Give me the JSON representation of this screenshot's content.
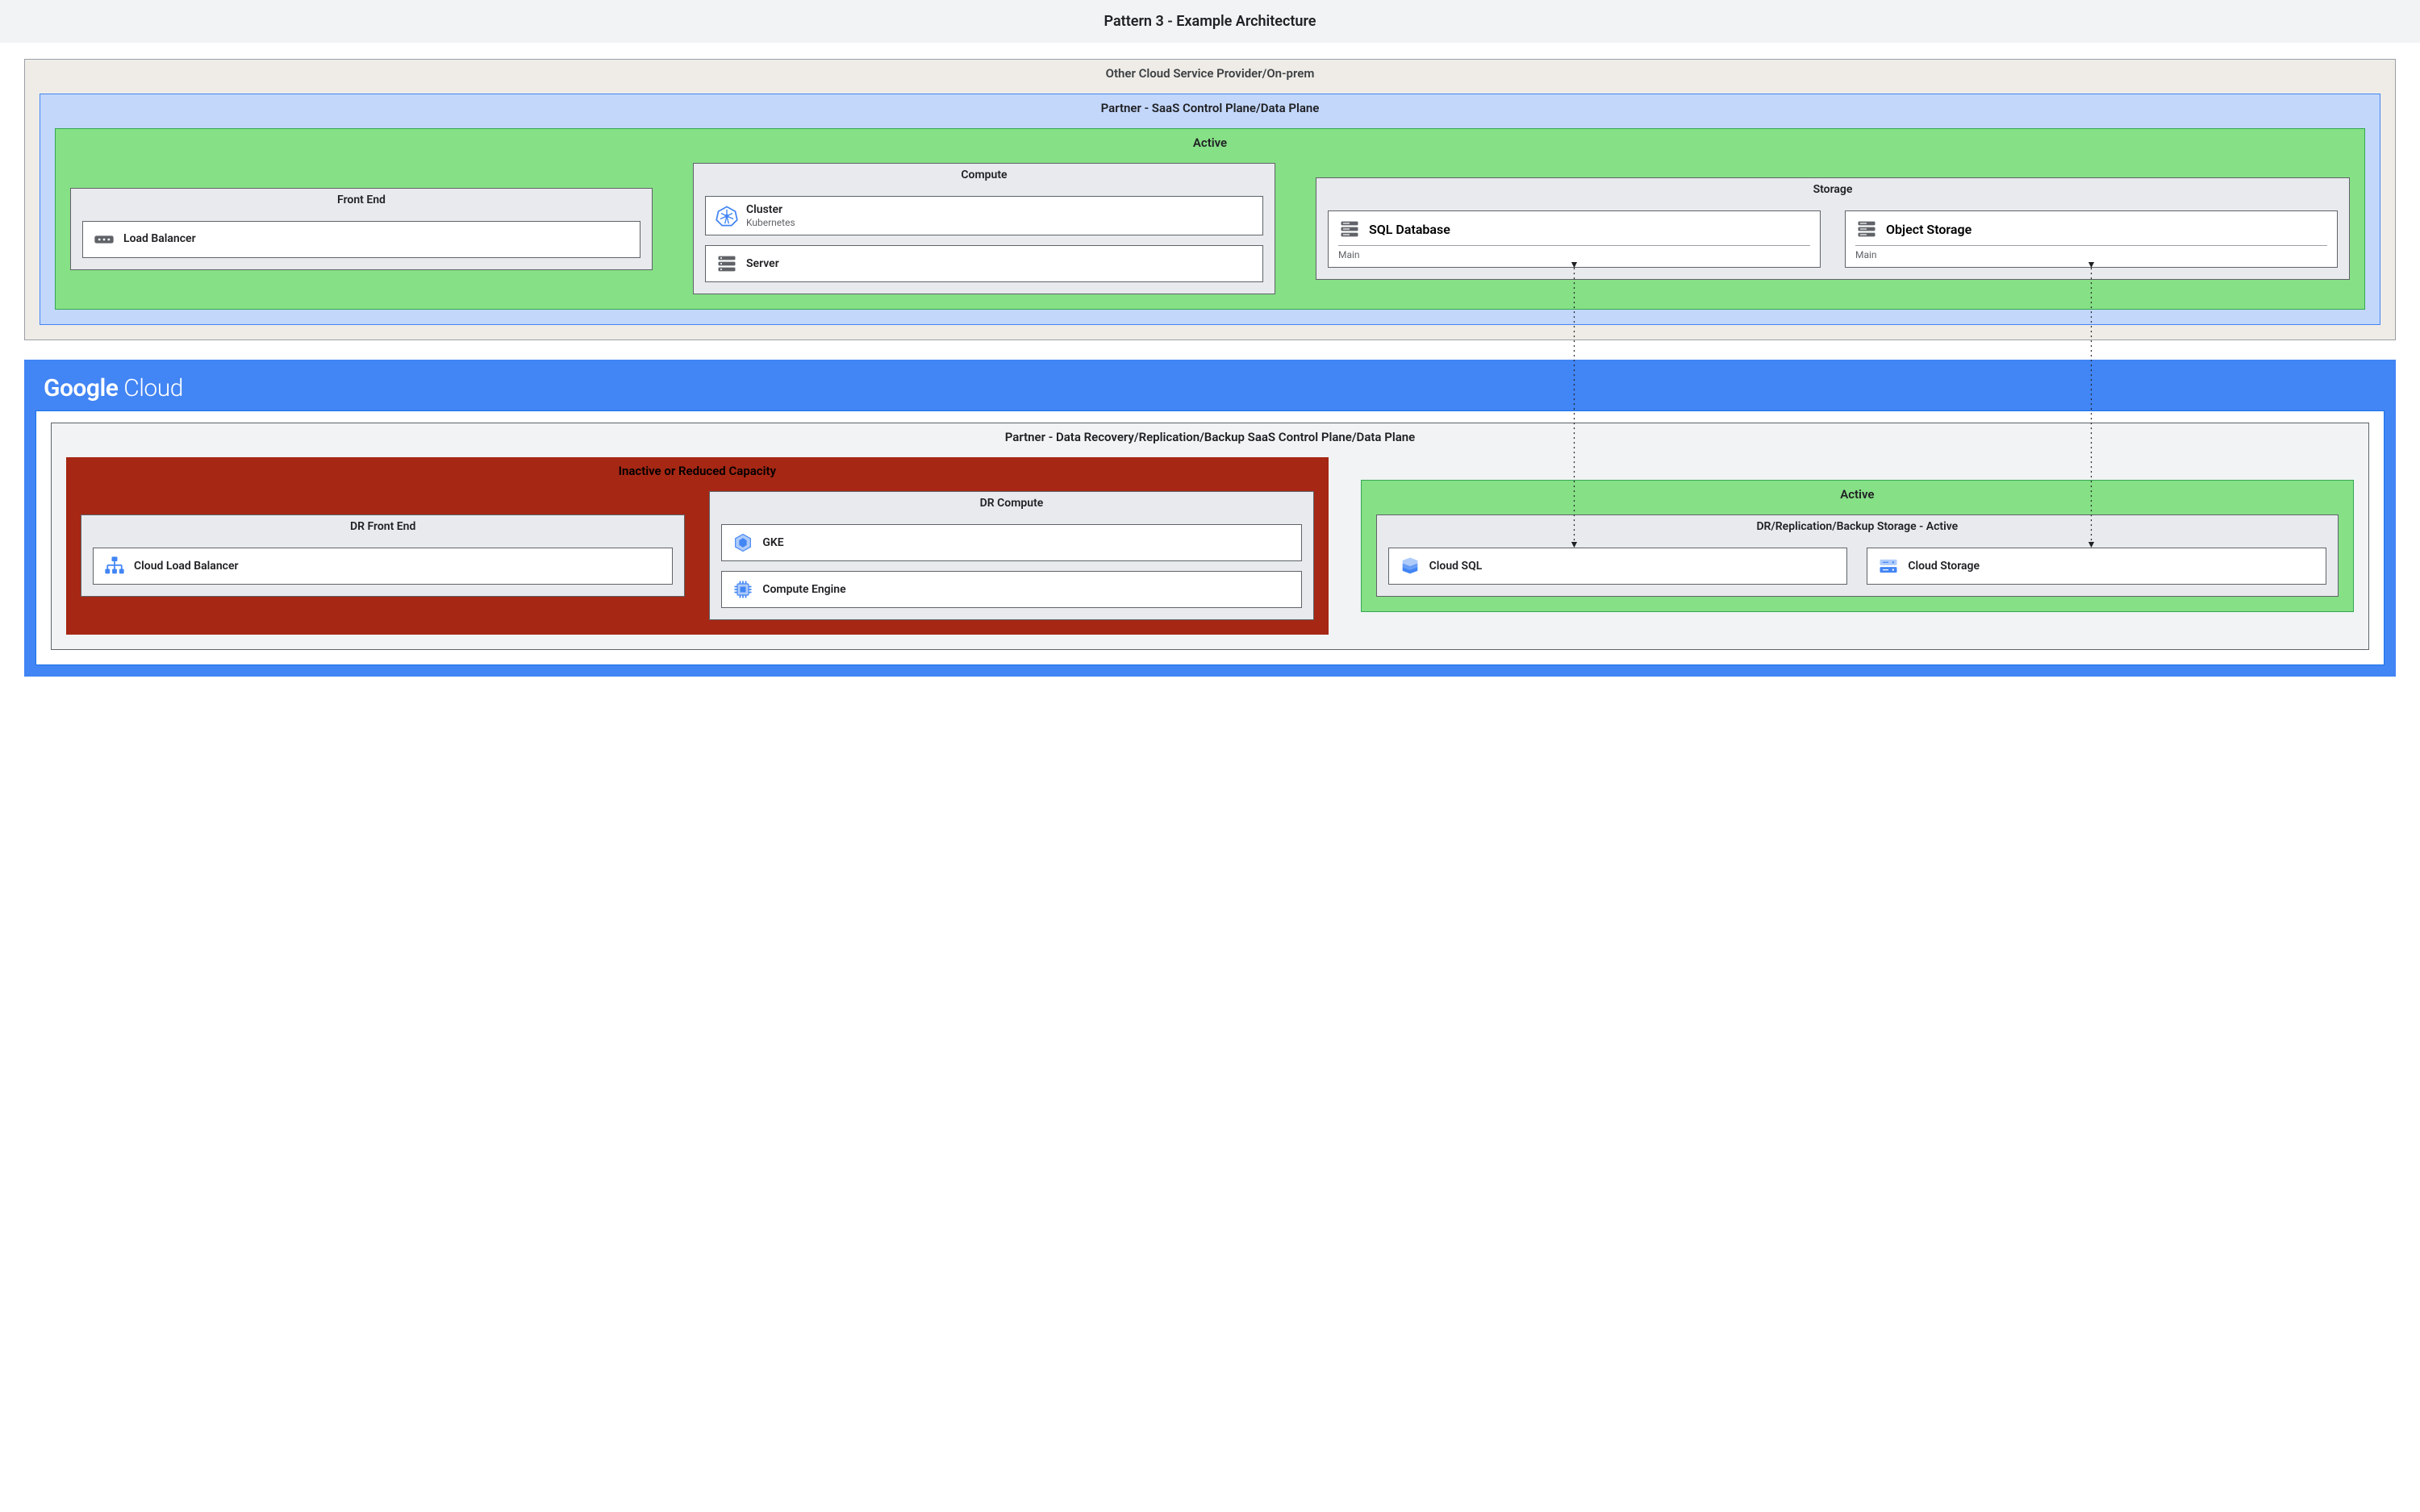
{
  "header": {
    "title": "Pattern 3 - Example Architecture"
  },
  "top": {
    "otherCloud": "Other Cloud Service Provider/On-prem",
    "partnerSaas": "Partner - SaaS Control Plane/Data Plane",
    "active": "Active",
    "frontend": {
      "title": "Front End",
      "lb": "Load Balancer"
    },
    "compute": {
      "title": "Compute",
      "cluster": {
        "t1": "Cluster",
        "t2": "Kubernetes"
      },
      "server": {
        "t1": "Server"
      }
    },
    "storage": {
      "title": "Storage",
      "sql": {
        "t1": "SQL Database",
        "sub": "Main"
      },
      "obj": {
        "t1": "Object Storage",
        "sub": "Main"
      }
    }
  },
  "bottom": {
    "gcloudLogoBold": "Google",
    "gcloudLogoLight": " Cloud",
    "partnerDR": "Partner - Data Recovery/Replication/Backup SaaS Control Plane/Data Plane",
    "inactive": "Inactive or Reduced Capacity",
    "drFrontend": {
      "title": "DR Front End",
      "clb": "Cloud Load Balancer"
    },
    "drCompute": {
      "title": "DR Compute",
      "gke": "GKE",
      "ce": "Compute Engine"
    },
    "active2": "Active",
    "drStorage": {
      "title": "DR/Replication/Backup Storage - Active",
      "csql": "Cloud SQL",
      "cstorage": "Cloud Storage"
    }
  }
}
